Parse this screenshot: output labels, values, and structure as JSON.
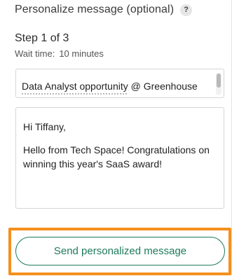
{
  "header": {
    "title": "Personalize message (optional)",
    "help_icon_glyph": "?",
    "help_icon": "question-mark-icon"
  },
  "step": {
    "title": "Step 1 of 3",
    "wait_label": "Wait time:",
    "wait_value": "10 minutes"
  },
  "subject": {
    "value": "Data Analyst opportunity @ Greenhouse"
  },
  "message": {
    "greeting": "Hi Tiffany,",
    "body": "Hello from Tech Space! Congratulations on winning this year's SaaS award!"
  },
  "actions": {
    "send_label": "Send personalized message"
  },
  "colors": {
    "accent": "#1f7a5a",
    "highlight": "#f5901e"
  }
}
